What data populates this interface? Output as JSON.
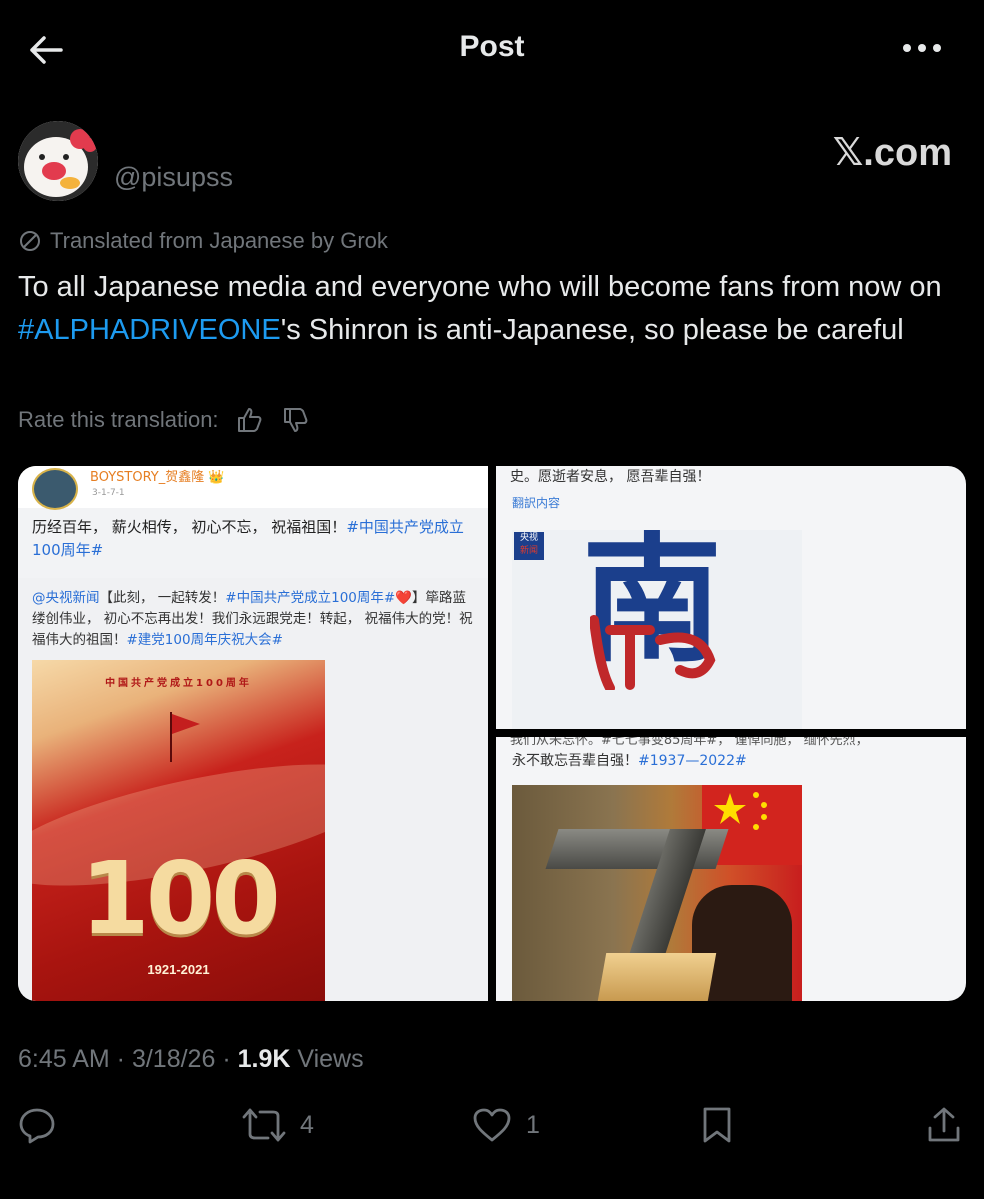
{
  "header": {
    "title": "Post"
  },
  "author": {
    "handle": "@pisupss"
  },
  "watermark": "𝕏.com",
  "translation": {
    "note": "Translated from Japanese by Grok",
    "rate_label": "Rate this translation:"
  },
  "post": {
    "line1": "To all Japanese media and everyone who will become fans from now on",
    "hashtag": "#ALPHADRIVEONE",
    "line2": "'s Shinron is anti-Japanese, so please be careful"
  },
  "media": {
    "left": {
      "username": "BOYSTORY_贺鑫隆 👑",
      "sub": "3-1-7-1",
      "text1_plain": "历经百年，  薪火相传，  初心不忘，  祝福祖国！",
      "text1_tag": "#中国共产党成立100周年#",
      "text2_mention": "@央视新闻",
      "text2_a": "【此刻，  一起转发！",
      "text2_tag1": "#中国共产党成立100周年#",
      "text2_b": "❤️】筚路蓝缕创伟业，  初心不忘再出发！我们永远跟党走！转起，  祝福伟大的党！祝福伟大的祖国！",
      "text2_tag2": "#建党100周年庆祝大会#",
      "poster_top": "中国共产党成立100周年",
      "poster_number": "100",
      "poster_years": "1921-2021"
    },
    "top_right": {
      "text": "史。愿逝者安息，  愿吾辈自强！",
      "sub": "翻訳内容",
      "logo_top": "央视",
      "logo_bottom": "新闻",
      "glyph": "南"
    },
    "bottom_right": {
      "partial": "我们从未忘怀。#七七事变85周年#，  谨悼同胞，  缅怀先烈，",
      "text": "永不敢忘吾辈自强！",
      "tag": "#1937—2022#"
    }
  },
  "meta": {
    "time": "6:45 AM",
    "sep": " · ",
    "date": "3/18/26",
    "views_count": "1.9K",
    "views_label": " Views"
  },
  "actions": {
    "reposts": "4",
    "likes": "1"
  },
  "colors": {
    "accent": "#1d9bf0",
    "muted": "#71767b",
    "text": "#e7e9ea"
  }
}
